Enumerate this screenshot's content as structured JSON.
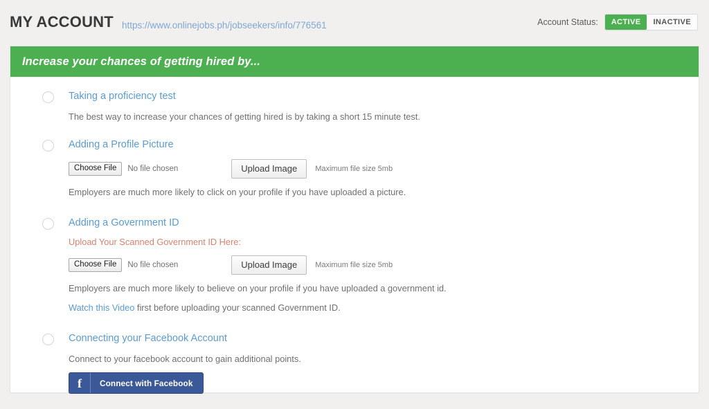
{
  "header": {
    "title": "MY ACCOUNT",
    "profile_url": "https://www.onlinejobs.ph/jobseekers/info/776561",
    "status_label": "Account Status:",
    "status_active": "ACTIVE",
    "status_inactive": "INACTIVE",
    "active_color": "#4caf50"
  },
  "panel": {
    "heading": "Increase your chances of getting hired by...",
    "heading_bg": "#4caf50"
  },
  "items": [
    {
      "title": "Taking a proficiency test",
      "description": "The best way to increase your chances of getting hired is by taking a short 15 minute test."
    },
    {
      "title": "Adding a Profile Picture",
      "choose_file_label": "Choose File",
      "file_name": "No file chosen",
      "upload_label": "Upload Image",
      "max_size": "Maximum file size 5mb",
      "description": "Employers are much more likely to click on your profile if you have uploaded a picture."
    },
    {
      "title": "Adding a Government ID",
      "note": "Upload Your Scanned Government ID Here:",
      "note_color": "#d9826e",
      "choose_file_label": "Choose File",
      "file_name": "No file chosen",
      "upload_label": "Upload Image",
      "max_size": "Maximum file size 5mb",
      "description": "Employers are much more likely to believe on your profile if you have uploaded a government id.",
      "video_link": "Watch this Video",
      "video_rest": " first before uploading your scanned Government ID."
    },
    {
      "title": "Connecting your Facebook Account",
      "description": "Connect to your facebook account to gain additional points.",
      "facebook_button": "Connect with Facebook",
      "facebook_icon": "f",
      "facebook_color": "#3b5998"
    }
  ]
}
